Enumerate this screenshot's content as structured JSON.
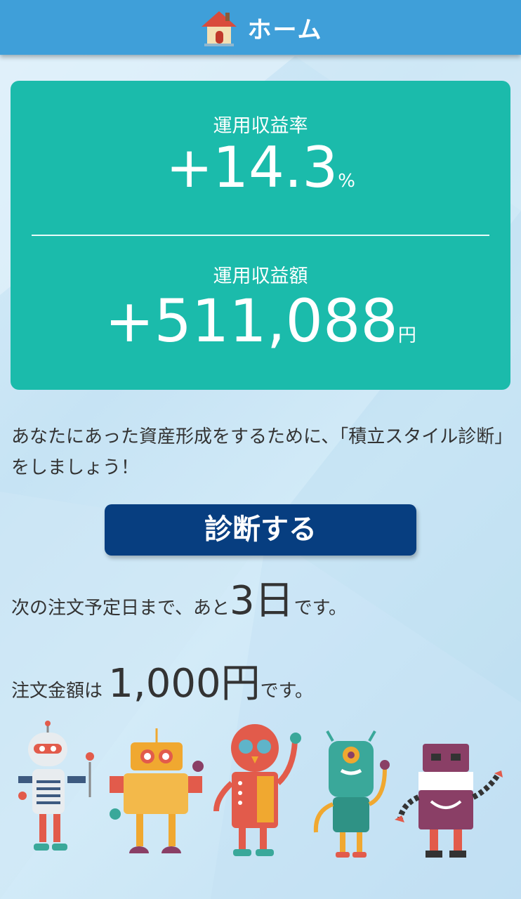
{
  "header": {
    "title": "ホーム",
    "icon": "house-icon"
  },
  "summary": {
    "rate_label": "運用収益率",
    "rate_value": "+14.3",
    "rate_unit": "%",
    "amount_label": "運用収益額",
    "amount_value": "+511,088",
    "amount_unit": "円"
  },
  "message": "あなたにあった資産形成をするために、「積立スタイル診断」をしましょう！",
  "cta": {
    "label": "診断する"
  },
  "next_order": {
    "prefix": "次の注文予定日まで、あと",
    "days": "3日",
    "suffix": "です。"
  },
  "order_amount": {
    "prefix": "注文金額は",
    "value": "1,000円",
    "suffix": "です。"
  },
  "colors": {
    "header": "#3f9fd9",
    "card": "#1bbbab",
    "button": "#073e80"
  }
}
